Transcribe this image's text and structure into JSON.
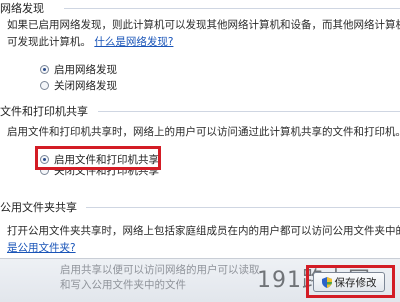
{
  "network_discovery": {
    "heading": "网络发现",
    "description": "如果已启用网络发现，则此计算机可以发现其他网络计算机和设备，而其他网络计算机亦",
    "prefix": "可发现此计算机。",
    "link": "什么是网络发现?",
    "options": [
      {
        "label": "启用网络发现",
        "checked": true
      },
      {
        "label": "关闭网络发现",
        "checked": false
      }
    ]
  },
  "file_printer_sharing": {
    "heading": "文件和打印机共享",
    "description": "启用文件和打印机共享时，网络上的用户可以访问通过此计算机共享的文件和打印机。",
    "options": [
      {
        "label": "启用文件和打印机共享",
        "checked": true
      },
      {
        "label": "关闭文件和打印机共享",
        "checked": false
      }
    ]
  },
  "public_folder_sharing": {
    "heading": "公用文件夹共享",
    "description": "打开公用文件夹共享时，网络上包括家庭组成员在内的用户都可以访问公用文件夹中的文",
    "link": "是公用文件夹?"
  },
  "footer": {
    "faded_text": "启用共享以便可以访问网络的用户可以读取和写入公用文件夹中的文件",
    "watermark": "191路由网",
    "save_button": "保存修改"
  },
  "colors": {
    "highlight": "#d31c25",
    "link": "#1a55b8"
  }
}
